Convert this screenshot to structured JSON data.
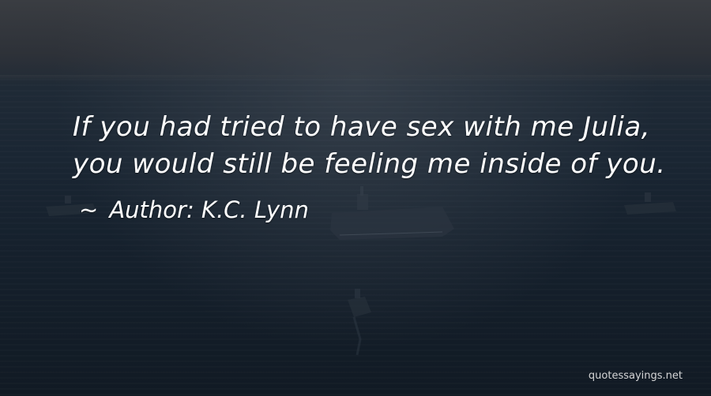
{
  "quote": {
    "lines": [
      "If you had tried to have sex with me Julia,",
      "you would still be feeling me inside of you."
    ]
  },
  "author": {
    "dash": "~",
    "label": "Author: K.C. Lynn"
  },
  "watermark": "quotessayings.net"
}
